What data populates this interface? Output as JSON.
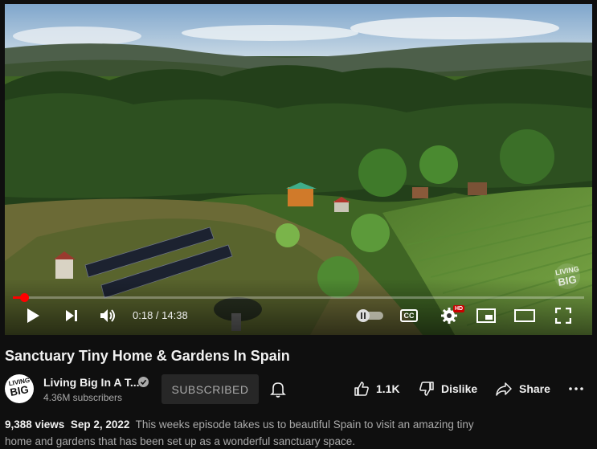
{
  "player": {
    "current_time": "0:18",
    "duration": "14:38",
    "time_separator": " / ",
    "progress_fraction": 0.02,
    "watermark_text_line1": "LIVING",
    "watermark_text_line2": "BIG",
    "settings_badge": "HD",
    "cc_label": "CC",
    "icons": [
      "play-icon",
      "next-icon",
      "volume-icon",
      "autoplay-toggle-icon",
      "captions-icon",
      "settings-icon",
      "miniplayer-icon",
      "theater-icon",
      "fullscreen-icon"
    ],
    "accent_color": "#ff0000"
  },
  "video": {
    "title": "Sanctuary Tiny Home & Gardens In Spain"
  },
  "channel": {
    "name": "Living Big In A T...",
    "subscribers": "4.36M subscribers",
    "avatar_line1": "LIVING",
    "avatar_line2": "BIG",
    "subscribe_label": "SUBSCRIBED"
  },
  "actions": {
    "likes": "1.1K",
    "dislike_label": "Dislike",
    "share_label": "Share"
  },
  "description": {
    "views": "9,388 views",
    "date": "Sep 2, 2022",
    "text": "This weeks episode takes us to beautiful Spain to visit an amazing tiny home and gardens that has been set up as a wonderful sanctuary space."
  }
}
